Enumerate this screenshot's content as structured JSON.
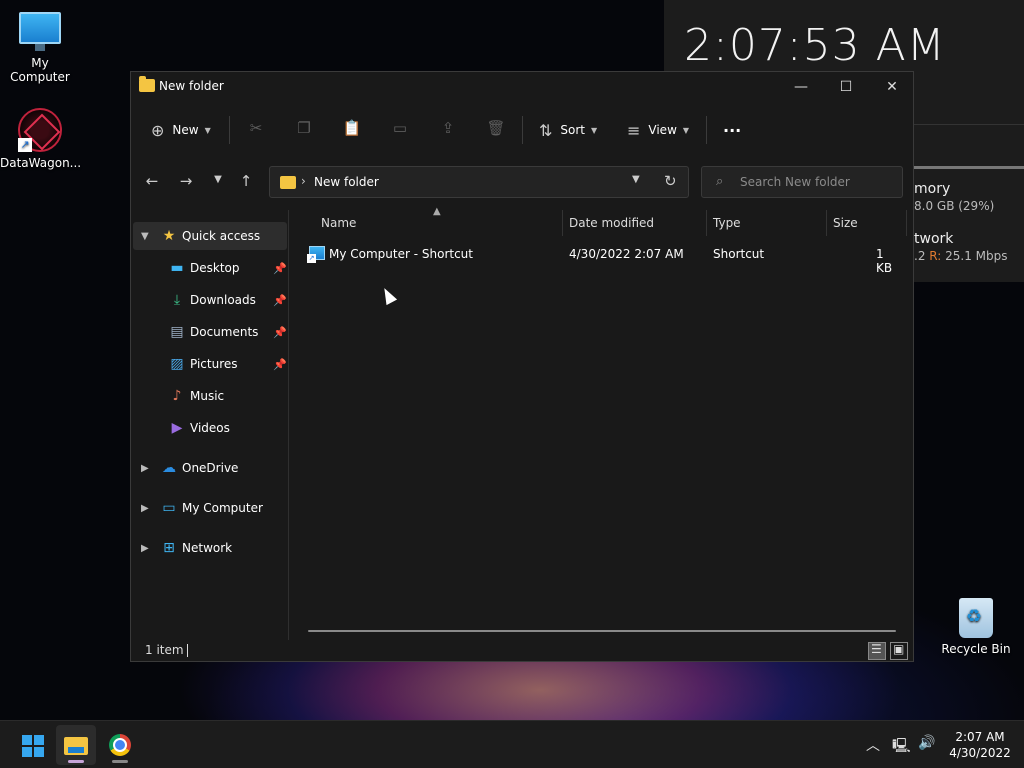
{
  "desktop": {
    "icons": [
      {
        "label": "My Computer"
      },
      {
        "label": "DataWagon..."
      },
      {
        "label": "Recycle Bin"
      }
    ],
    "widget": {
      "time": "2:07:53 AM",
      "memory_title": "mory",
      "memory_value": "8.0 GB (29%)",
      "network_title": "twork",
      "network_left": ".2",
      "network_r_label": "R:",
      "network_r_value": "25.1 Mbps"
    }
  },
  "window": {
    "title": "New folder",
    "controls": {
      "minimize": "—",
      "maximize": "☐",
      "close": "✕"
    },
    "toolbar": {
      "new_label": "New",
      "sort_label": "Sort",
      "view_label": "View",
      "more_label": "···"
    },
    "address": {
      "path": "New folder",
      "separator": "›"
    },
    "search": {
      "placeholder": "Search New folder"
    },
    "nav": {
      "quick_access": "Quick access",
      "items": [
        {
          "label": "Desktop"
        },
        {
          "label": "Downloads"
        },
        {
          "label": "Documents"
        },
        {
          "label": "Pictures"
        },
        {
          "label": "Music"
        },
        {
          "label": "Videos"
        }
      ],
      "roots": [
        {
          "label": "OneDrive"
        },
        {
          "label": "My Computer"
        },
        {
          "label": "Network"
        }
      ]
    },
    "columns": {
      "name": "Name",
      "date_modified": "Date modified",
      "type": "Type",
      "size": "Size"
    },
    "files": [
      {
        "name": "My Computer - Shortcut",
        "date_modified": "4/30/2022 2:07 AM",
        "type": "Shortcut",
        "size": "1 KB"
      }
    ],
    "status": {
      "count": "1 item"
    }
  },
  "taskbar": {
    "time": "2:07 AM",
    "date": "4/30/2022"
  },
  "colors": {
    "accent": "#36a7ef",
    "folder": "#f4c542",
    "window_bg": "#191919",
    "taskbar_bg": "#1c1c1c"
  }
}
